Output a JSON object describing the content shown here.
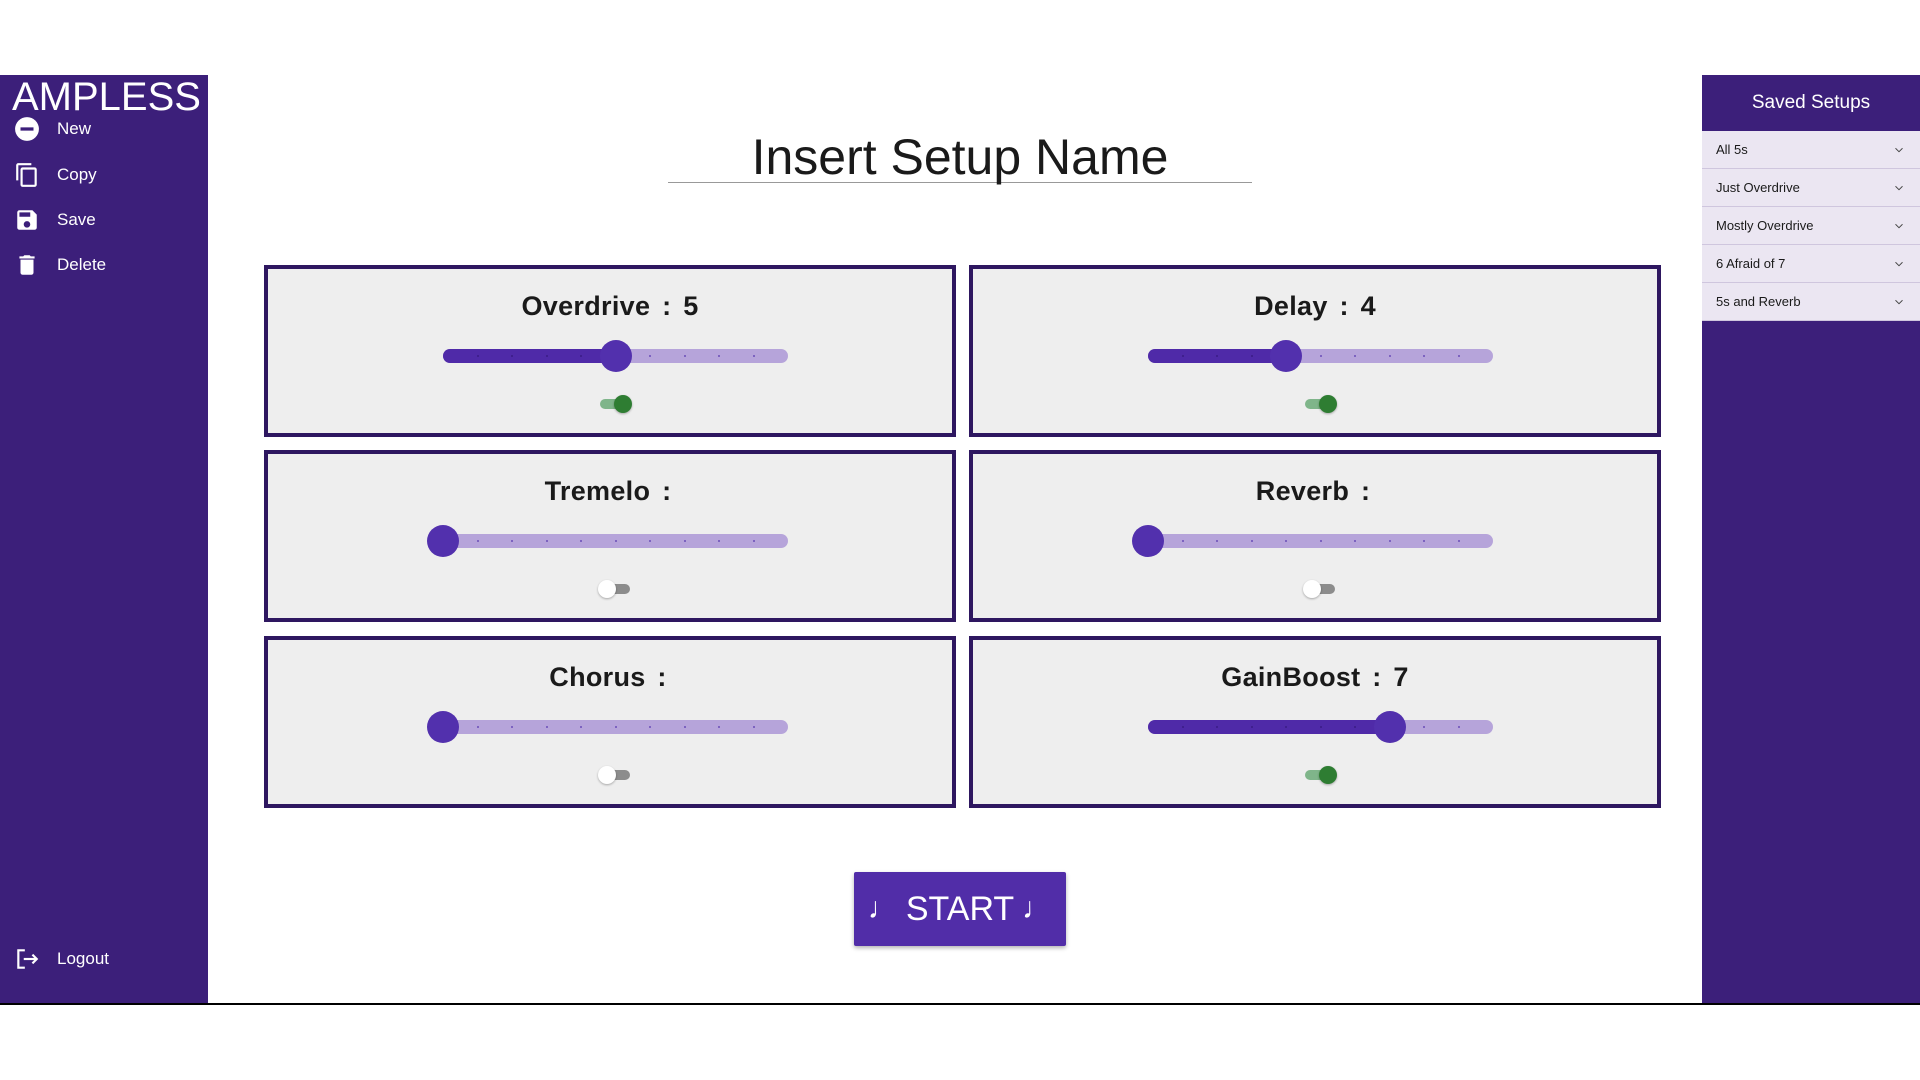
{
  "app": {
    "brand": "AMPLESS"
  },
  "sidebar": {
    "items": [
      {
        "label": "New",
        "icon": "minus-circle-icon"
      },
      {
        "label": "Copy",
        "icon": "copy-icon"
      },
      {
        "label": "Save",
        "icon": "floppy-disk-icon"
      },
      {
        "label": "Delete",
        "icon": "trash-icon"
      }
    ],
    "logout_label": "Logout"
  },
  "main": {
    "setup_name": "Insert Setup Name",
    "start_label": "START",
    "start_icon": "music-note-icon"
  },
  "effects": [
    {
      "name": "Overdrive",
      "value": "5",
      "level": 5,
      "max": 10,
      "enabled": true
    },
    {
      "name": "Delay",
      "value": "4",
      "level": 4,
      "max": 10,
      "enabled": true
    },
    {
      "name": "Tremelo",
      "value": "",
      "level": 0,
      "max": 10,
      "enabled": false
    },
    {
      "name": "Reverb",
      "value": "",
      "level": 0,
      "max": 10,
      "enabled": false
    },
    {
      "name": "Chorus",
      "value": "",
      "level": 0,
      "max": 10,
      "enabled": false
    },
    {
      "name": "GainBoost",
      "value": "7",
      "level": 7,
      "max": 10,
      "enabled": true
    }
  ],
  "saved_setups": {
    "title": "Saved Setups",
    "items": [
      "All 5s",
      "Just Overdrive",
      "Mostly Overdrive",
      "6 Afraid of 7",
      "5s and Reverb"
    ]
  },
  "colors": {
    "sidebar": "#3c1f7a",
    "accent": "#512da8",
    "slider_rail": "#b6a4da",
    "toggle_on": "#2e7d32"
  }
}
